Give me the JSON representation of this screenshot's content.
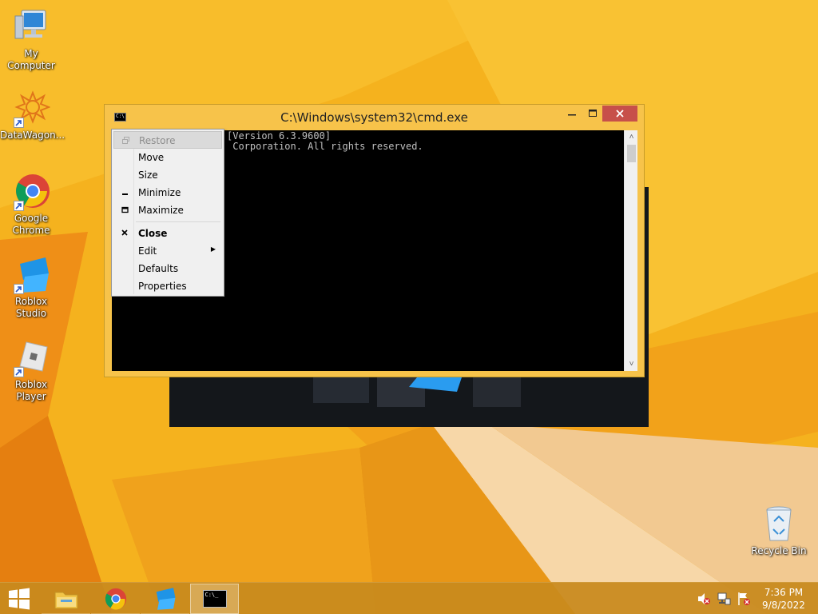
{
  "desktop": {
    "icons": [
      {
        "label": "My Computer",
        "icon": "my-computer-icon"
      },
      {
        "label": "DataWagon...",
        "icon": "datawagon-icon"
      },
      {
        "label": "Google\nChrome",
        "icon": "chrome-icon"
      },
      {
        "label": "Roblox Studio",
        "icon": "roblox-studio-icon"
      },
      {
        "label": "Roblox Player",
        "icon": "roblox-player-icon"
      },
      {
        "label": "Recycle Bin",
        "icon": "recycle-bin-icon"
      }
    ]
  },
  "cmd_window": {
    "title": "C:\\Windows\\system32\\cmd.exe",
    "console_lines": [
      "[Version 6.3.9600]",
      " Corporation. All rights reserved."
    ],
    "close_color": "#c7504a"
  },
  "system_menu": {
    "items": [
      {
        "label": "Restore",
        "disabled": true,
        "icon": "restore-icon"
      },
      {
        "label": "Move"
      },
      {
        "label": "Size"
      },
      {
        "label": "Minimize",
        "icon": "minimize-icon"
      },
      {
        "label": "Maximize",
        "icon": "maximize-icon"
      },
      {
        "label": "Close",
        "bold": true,
        "icon": "close-icon"
      },
      {
        "label": "Edit",
        "submenu": true
      },
      {
        "label": "Defaults"
      },
      {
        "label": "Properties"
      }
    ]
  },
  "taskbar": {
    "items": [
      {
        "name": "file-explorer",
        "icon": "folder-icon"
      },
      {
        "name": "google-chrome",
        "icon": "chrome-icon"
      },
      {
        "name": "roblox-studio",
        "icon": "roblox-studio-icon"
      },
      {
        "name": "command-prompt",
        "icon": "cmd-icon",
        "active": true
      }
    ],
    "clock": {
      "time": "7:36 PM",
      "date": "9/8/2022"
    },
    "tray": [
      "speaker-muted-icon",
      "network-icon",
      "action-center-flag-icon"
    ]
  },
  "colors": {
    "wallpaper_orange": "#f5b21e",
    "window_frame": "#f7c34a",
    "taskbar": "#c88a1d"
  }
}
